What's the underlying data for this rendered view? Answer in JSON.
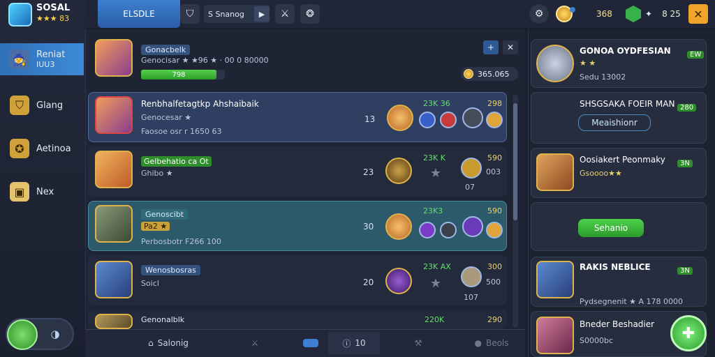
{
  "app": {
    "title": "SOSAL",
    "stars": "★★★",
    "level": "83"
  },
  "left_nav": [
    {
      "label": "Reniat",
      "sub": "IUU3",
      "icon": "avatar-icon"
    },
    {
      "label": "Glang",
      "icon": "shield-icon"
    },
    {
      "label": "Aetinoa",
      "icon": "medal-icon"
    },
    {
      "label": "Nex",
      "icon": "chest-icon"
    }
  ],
  "topbar": {
    "active_tab": "ELSDLE",
    "search_text": "S Snanog",
    "coins": "368",
    "gems": "8 25"
  },
  "header": {
    "name": "Gonacbelk",
    "sub": "Genocisar ★ ★96 ★ · 00 0 80000",
    "xp": "798",
    "currency": "365.065"
  },
  "rows": [
    {
      "name": "Renbhalfetagtkp Ahshaibaik",
      "tag": "Genocesar ★",
      "sub": "Faosoe osr r 1650 63",
      "rank": "13",
      "stat": "23K 36",
      "stat2": "298"
    },
    {
      "name": "",
      "tag": "Gelbehatio ca Ot",
      "sub": "Ghibo ★",
      "rank": "23",
      "stat": "23K K",
      "stat2": "590",
      "stat3": "003",
      "stat4": "07 "
    },
    {
      "name": "",
      "tag": "Genoscibt",
      "sub": "Pa2  ★",
      "sub2": "Perbosbotr F266 100",
      "rank": "30",
      "stat": "23K3",
      "stat2": "590"
    },
    {
      "name": "",
      "tag": "Wenosbosras",
      "sub": "Soicl",
      "rank": "20",
      "stat": "23K AX",
      "stat2": "300",
      "stat3": "500",
      "stat4": "107"
    },
    {
      "name": "",
      "tag": "Genonalblk",
      "sub": "",
      "rank": "",
      "stat": "220K",
      "stat2": "290"
    }
  ],
  "bottombar": {
    "left": "Salonig",
    "count": "10",
    "right": "Beols"
  },
  "right_panel": {
    "card1": {
      "title": "GONOA OYDFESIAN",
      "badge": "EW",
      "sub": "Sedu 13002"
    },
    "card2": {
      "title": "SHSGSAKA FOEIR MAN",
      "badge": "280",
      "button": "Meaishionr"
    },
    "card3": {
      "title": "Oosiakert Peonmaky",
      "badge": "3N",
      "sub": "Gsoooo★★"
    },
    "card4": {
      "button": "Sehanio"
    },
    "card5": {
      "title": "RAKIS NEBLICE",
      "badge": "3N",
      "sub": "Pydsegnenit  ★ A 178 0000"
    },
    "card6": {
      "title": "Bneder Beshadier",
      "sub": "S0000bc"
    }
  }
}
